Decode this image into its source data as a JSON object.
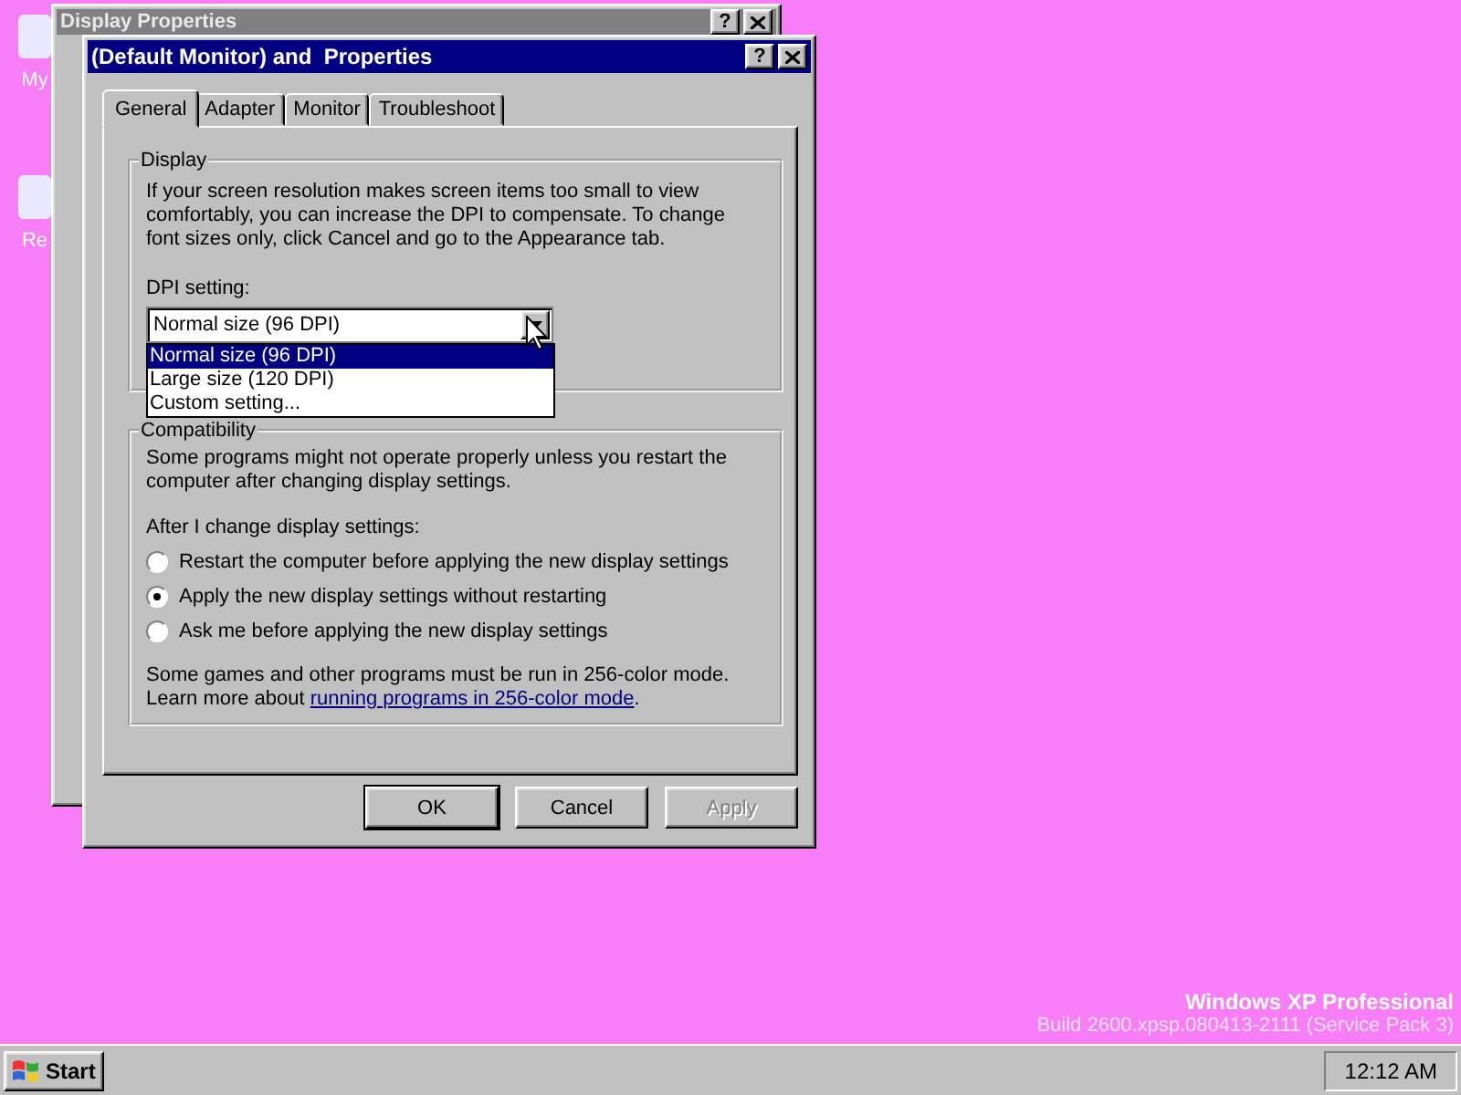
{
  "desktop": {
    "icons": [
      {
        "label": "My"
      },
      {
        "label": "Re"
      }
    ],
    "os_name": "Windows XP Professional",
    "os_build": "Build 2600.xpsp.080413-2111 (Service Pack 3)"
  },
  "background_window": {
    "title": "Display Properties",
    "help": "?"
  },
  "dialog": {
    "title": "(Default Monitor) and  Properties",
    "help": "?",
    "tabs": [
      {
        "label": "General",
        "selected": true
      },
      {
        "label": "Adapter",
        "selected": false
      },
      {
        "label": "Monitor",
        "selected": false
      },
      {
        "label": "Troubleshoot",
        "selected": false
      }
    ],
    "display_group": {
      "title": "Display",
      "text_lines": [
        "If your screen resolution makes screen items too small to view",
        "comfortably, you can increase the DPI to compensate.  To change",
        "font sizes only, click Cancel and go to the Appearance tab."
      ],
      "dpi_label": "DPI setting:",
      "dpi_value": "Normal size (96 DPI)",
      "expanded": true,
      "dpi_options": [
        {
          "label": "Normal size (96 DPI)",
          "selected": true
        },
        {
          "label": "Large size (120 DPI)",
          "selected": false
        },
        {
          "label": "Custom setting...",
          "selected": false
        }
      ]
    },
    "compatibility_group": {
      "title": "Compatibility",
      "text_lines": [
        "Some programs might not operate properly unless you restart the",
        "computer after changing display settings."
      ],
      "radio_label": "After I change display settings:",
      "radios": [
        {
          "label": "Restart the computer before applying the new display settings",
          "selected": false
        },
        {
          "label": "Apply the new display settings without restarting",
          "selected": true
        },
        {
          "label": "Ask me before applying the new display settings",
          "selected": false
        }
      ],
      "note": "Some games and other programs must be run in 256-color mode.",
      "learn_more": "Learn more about ",
      "link": "running programs in 256-color mode",
      "link_suffix": "."
    },
    "buttons": [
      {
        "label": "OK",
        "default": true,
        "disabled": false
      },
      {
        "label": "Cancel",
        "default": false,
        "disabled": false
      },
      {
        "label": "Apply",
        "default": false,
        "disabled": true
      }
    ]
  },
  "taskbar": {
    "start": "Start",
    "clock": "12:12 AM"
  }
}
